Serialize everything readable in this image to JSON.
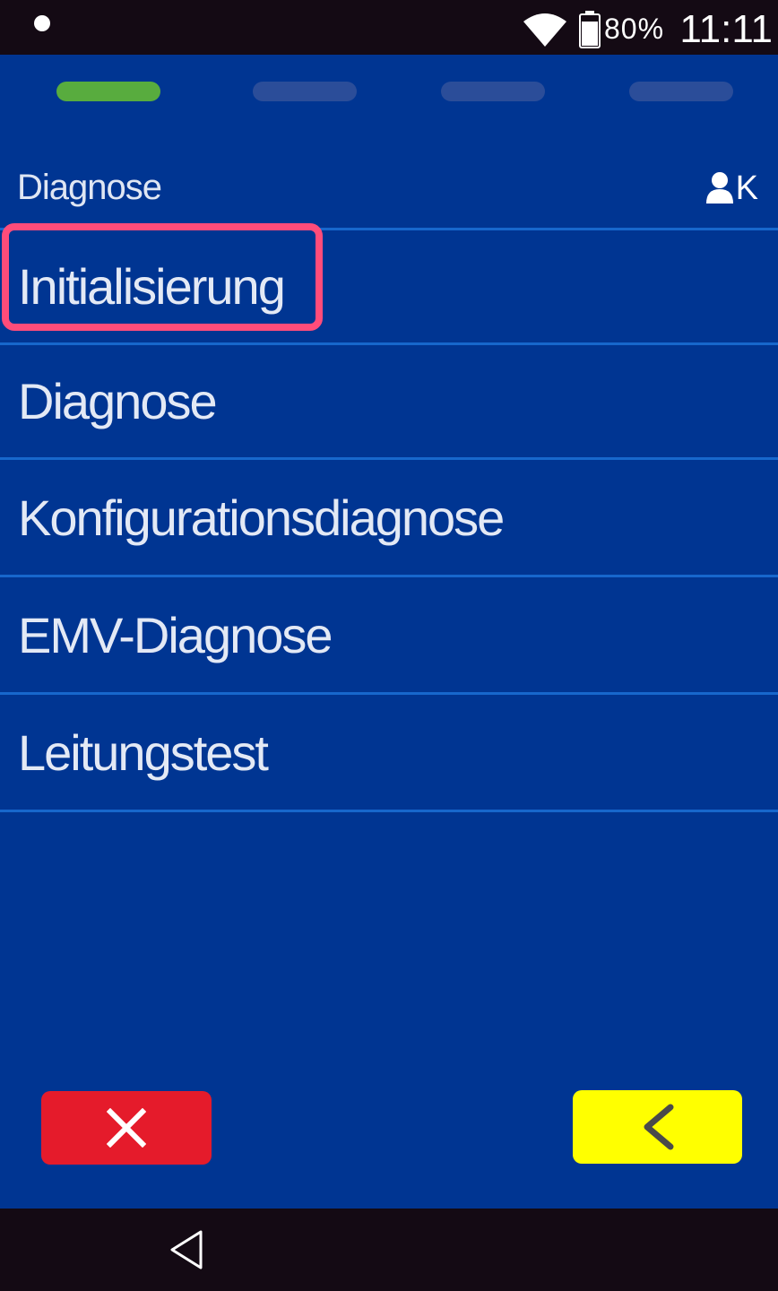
{
  "status_bar": {
    "battery": "80%",
    "time": "11:11",
    "icons": [
      "notification-dot-icon",
      "wifi-icon",
      "battery-icon"
    ]
  },
  "progress": {
    "total_steps": 4,
    "current_step": 1,
    "active_color": "#58ac3e",
    "inactive_color": "#2b4d99"
  },
  "header": {
    "title": "Diagnose",
    "user_icon": "user-icon",
    "user_letter": "K"
  },
  "menu": {
    "items": [
      {
        "label": "Initialisierung",
        "highlighted": true
      },
      {
        "label": "Diagnose"
      },
      {
        "label": "Konfigurationsdiagnose"
      },
      {
        "label": "EMV-Diagnose"
      },
      {
        "label": "Leitungstest"
      }
    ]
  },
  "buttons": {
    "cancel_icon": "close-icon",
    "cancel_color": "#e51b2b",
    "back_icon": "chevron-left-icon",
    "back_color": "#ffff00"
  },
  "nav_bar": {
    "back_icon": "nav-back-triangle-icon"
  },
  "colors": {
    "background": "#003592",
    "divider": "#1767cc",
    "highlight": "#ff4c7a",
    "status_bar": "#140a14"
  }
}
